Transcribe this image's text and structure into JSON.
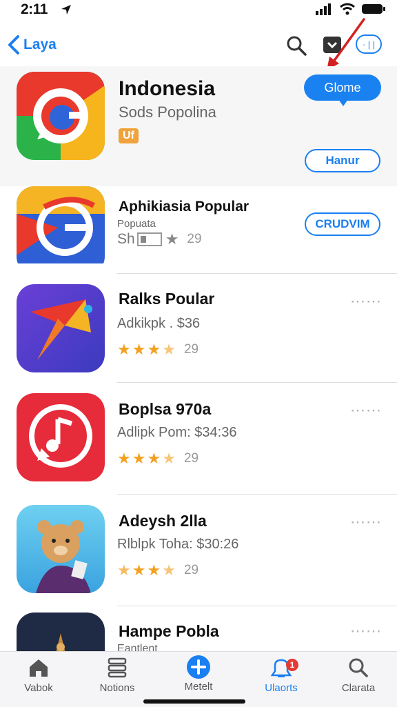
{
  "status": {
    "time": "2:11"
  },
  "nav": {
    "back_label": "Laya",
    "profile_label": "· | |"
  },
  "header": {
    "title": "Indonesia",
    "subtitle": "Sods Popolina",
    "badge": "Uf",
    "primary_button": "Glome",
    "outline_button": "Hanur"
  },
  "rows": [
    {
      "title": "Aphikiasia Popular",
      "subtitle": "Popuata",
      "meta": "Sh",
      "rating": "29",
      "button": "CRUDVIM"
    },
    {
      "title": "Ralks Poular",
      "subtitle": "Adkikpk . $36",
      "rating": "29"
    },
    {
      "title": "Boplsa 970a",
      "subtitle": "Adlipk Pom: $34:36",
      "rating": "29"
    },
    {
      "title": "Adeysh 2lla",
      "subtitle": "Rlblpk Toha: $30:26",
      "rating": "29"
    },
    {
      "title": "Hampe Pobla",
      "subtitle": "Eantlent"
    }
  ],
  "tabs": [
    {
      "label": "Vabok",
      "icon": "home-icon"
    },
    {
      "label": "Notions",
      "icon": "stack-icon"
    },
    {
      "label": "Metelt",
      "icon": "plus-circle-icon"
    },
    {
      "label": "Ulaorts",
      "icon": "bell-icon",
      "badge": "1"
    },
    {
      "label": "Clarata",
      "icon": "search-icon"
    }
  ],
  "colors": {
    "accent": "#1a7ff0",
    "star": "#f2a11f",
    "badge_red": "#e53935"
  }
}
